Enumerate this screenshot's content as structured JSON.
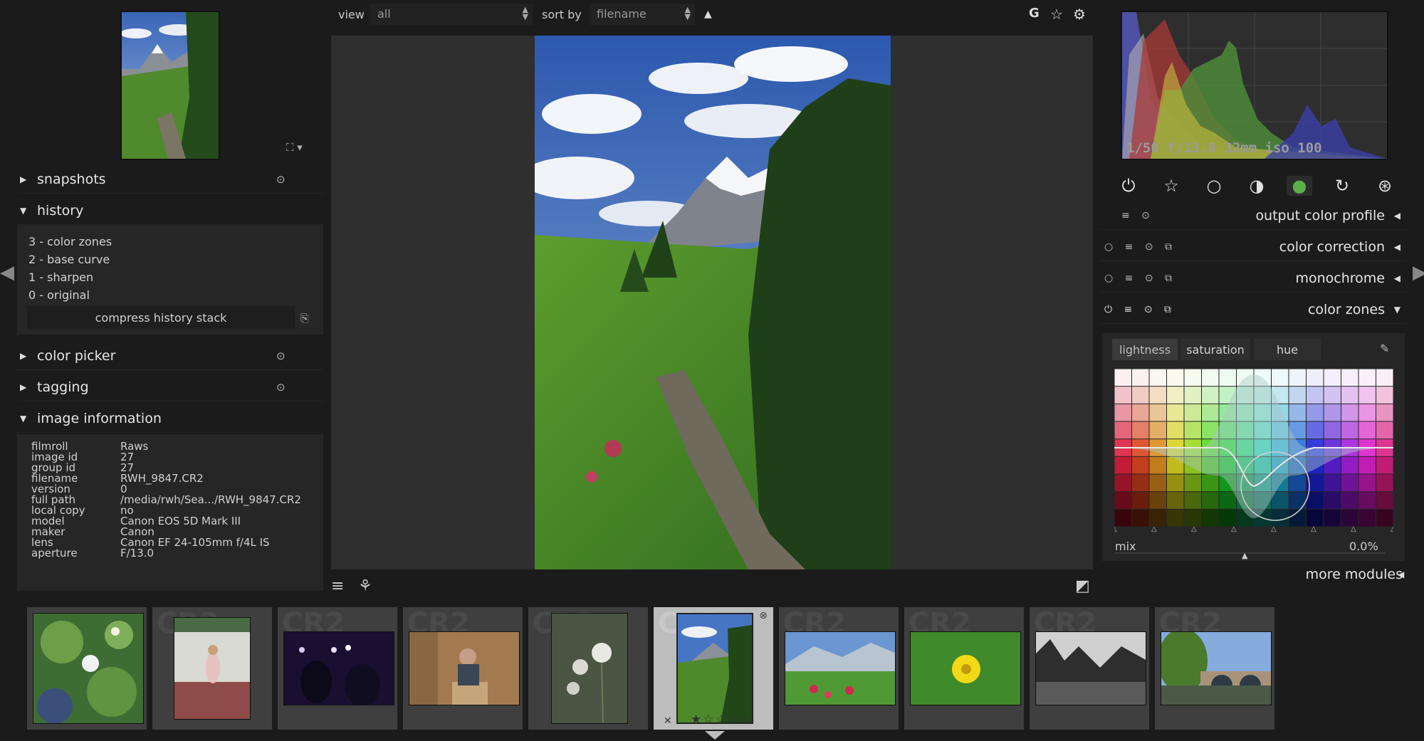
{
  "topbar": {
    "view_label": "view",
    "view_value": "all",
    "sort_label": "sort by",
    "sort_value": "filename",
    "sort_dir_icon": "triangle-up-icon",
    "icons": [
      "grouping-icon",
      "star-icon",
      "gear-icon"
    ],
    "grouping_letter": "G"
  },
  "left_panel": {
    "snapshots": {
      "title": "snapshots",
      "expanded": false
    },
    "history": {
      "title": "history",
      "expanded": true,
      "items": [
        "3 - color zones",
        "2 - base curve",
        "1 - sharpen",
        "0 - original"
      ],
      "compress_label": "compress history stack"
    },
    "color_picker": {
      "title": "color picker",
      "expanded": false
    },
    "tagging": {
      "title": "tagging",
      "expanded": false
    },
    "image_information": {
      "title": "image information",
      "expanded": true,
      "rows": [
        {
          "key": "filmroll",
          "value": "Raws"
        },
        {
          "key": "image id",
          "value": "27"
        },
        {
          "key": "group id",
          "value": "27"
        },
        {
          "key": "filename",
          "value": "RWH_9847.CR2"
        },
        {
          "key": "version",
          "value": "0"
        },
        {
          "key": "full path",
          "value": "/media/rwh/Sea.../RWH_9847.CR2"
        },
        {
          "key": "local copy",
          "value": "no"
        },
        {
          "key": "model",
          "value": "Canon EOS 5D Mark III"
        },
        {
          "key": "maker",
          "value": "Canon"
        },
        {
          "key": "lens",
          "value": "Canon EF 24-105mm f/4L IS"
        },
        {
          "key": "aperture",
          "value": "F/13.0"
        }
      ]
    }
  },
  "right_panel": {
    "histogram_info": "1/50 f/13.0 32mm iso 100",
    "module_groups": [
      "power-icon",
      "star-outline-icon",
      "circle-icon",
      "gradient-circle-icon",
      "color-circle-icon",
      "rotate-icon",
      "aperture-icon"
    ],
    "modules": [
      {
        "name": "output color profile"
      },
      {
        "name": "color correction"
      },
      {
        "name": "monochrome"
      },
      {
        "name": "color zones",
        "expanded": true
      }
    ],
    "color_zones": {
      "tabs": [
        "lightness",
        "saturation",
        "hue"
      ],
      "active_tab": "lightness",
      "mix_label": "mix",
      "mix_value": "0.0%"
    },
    "more_modules": "more modules"
  },
  "filmstrip": {
    "watermark": "CR2",
    "selected_index": 5,
    "selected_rating": 1
  }
}
